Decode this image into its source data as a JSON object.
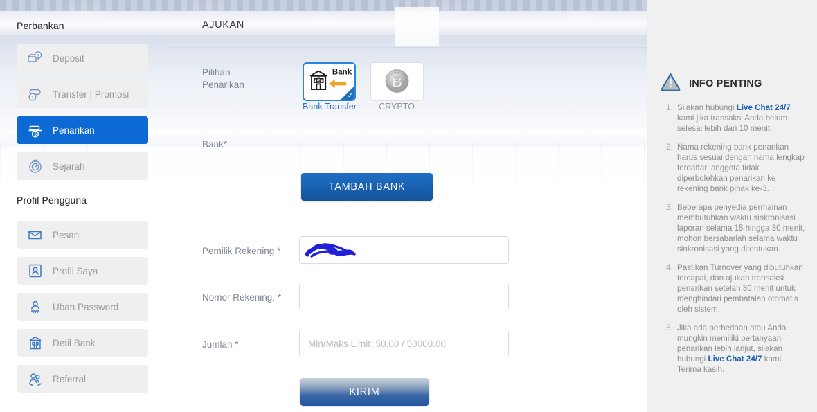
{
  "sidebar": {
    "banking_header": "Perbankan",
    "profile_header": "Profil Pengguna",
    "banking_items": [
      {
        "label": "Deposit",
        "icon": "deposit-icon",
        "active": false
      },
      {
        "label": "Transfer | Promosi",
        "icon": "transfer-icon",
        "active": false
      },
      {
        "label": "Penarikan",
        "icon": "withdraw-icon",
        "active": true
      },
      {
        "label": "Sejarah",
        "icon": "history-icon",
        "active": false
      }
    ],
    "profile_items": [
      {
        "label": "Pesan",
        "icon": "envelope-icon"
      },
      {
        "label": "Profil Saya",
        "icon": "user-card-icon"
      },
      {
        "label": "Ubah Password",
        "icon": "user-key-icon"
      },
      {
        "label": "Detil Bank",
        "icon": "bank-icon"
      },
      {
        "label": "Referral",
        "icon": "referral-icon"
      }
    ]
  },
  "main": {
    "page_title": "AJUKAN",
    "method_label_line1": "Pilihan",
    "method_label_line2": "Penarikan",
    "method_required": "*",
    "methods": [
      {
        "name": "bank-transfer",
        "caption": "Bank Transfer",
        "badge_text": "Bank",
        "selected": true
      },
      {
        "name": "crypto",
        "caption": "CRYPTO",
        "selected": false
      }
    ],
    "bank_label": "Bank*",
    "add_bank_button": "TAMBAH BANK",
    "fields": [
      {
        "name": "account-owner",
        "label": "Pemilik Rekening",
        "required": "*",
        "value": "",
        "placeholder": "",
        "redacted": true
      },
      {
        "name": "account-number",
        "label": "Nomor Rekening.",
        "required": "*",
        "value": "",
        "placeholder": "",
        "redacted": false
      },
      {
        "name": "amount",
        "label": "Jumlah",
        "required": "*",
        "value": "",
        "placeholder": "Min/Maks Limit: 50.00 / 50000.00",
        "redacted": false
      }
    ],
    "submit_button": "KIRIM"
  },
  "info": {
    "title": "INFO PENTING",
    "icon": "warning-triangle-icon",
    "items": [
      {
        "pre": "Silakan hubungi ",
        "link": "Live Chat 24/7",
        "post": " kami jika transaksi Anda belum selesai lebih dari 10 menit."
      },
      {
        "pre": "Nama rekening bank penarikan harus sesuai dengan nama lengkap terdaftar, anggota tidak diperbolehkan penarikan ke rekening bank pihak ke-3.",
        "link": "",
        "post": ""
      },
      {
        "pre": "Beberapa penyedia permainan membutuhkan waktu sinkronisasi laporan selama 15 hingga 30 menit, mohon bersabarlah selama waktu sinkronisasi yang ditentukan.",
        "link": "",
        "post": ""
      },
      {
        "pre": "Pastikan Turnover yang dibutuhkan tercapai, dan ajukan transaksi penarikan setelah 30 menit untuk menghindari pembatalan otomatis oleh sistem.",
        "link": "",
        "post": ""
      },
      {
        "pre": "Jika ada perbedaan atau Anda mungkin memiliki pertanyaan penarikan lebih lanjut, silakan hubungi ",
        "link": "Live Chat 24/7",
        "post": " kami. Terima kasih."
      }
    ]
  },
  "colors": {
    "accent_blue": "#0d6ad5",
    "link_blue": "#1a5fb4",
    "button_blue": "#15529b",
    "panel_gray": "#f0f0f0",
    "item_gray": "#efefef",
    "muted_text": "#9a9a9a",
    "label_text": "#7d8694",
    "redaction_blue": "#2020d8"
  }
}
